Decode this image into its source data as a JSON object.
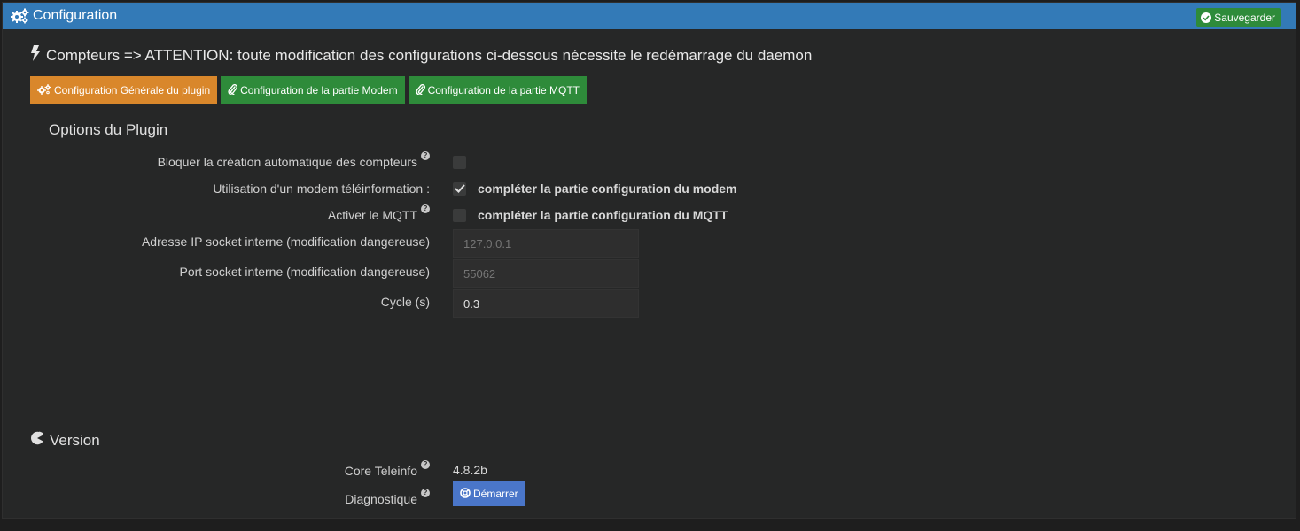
{
  "header": {
    "title": "Configuration",
    "save_label": "Sauvegarder",
    "icon": "cogs-icon",
    "color": "#337ab7"
  },
  "warning": {
    "title": "Compteurs => ATTENTION: toute modification des configurations ci-dessous nécessite le redémarrage du daemon",
    "icon": "bolt-icon"
  },
  "tabs": [
    {
      "label": "Configuration Générale du plugin",
      "icon": "cogs-icon",
      "color": "#d9872b",
      "active": true
    },
    {
      "label": "Configuration de la partie Modem",
      "icon": "paperclip-icon",
      "color": "#2e8b3a",
      "active": false
    },
    {
      "label": "Configuration de la partie MQTT",
      "icon": "paperclip-icon",
      "color": "#2e8b3a",
      "active": false
    }
  ],
  "options": {
    "title": "Options du Plugin",
    "block_auto_creation": {
      "label": "Bloquer la création automatique des compteurs",
      "checked": false
    },
    "use_modem": {
      "label": "Utilisation d'un modem téléinformation :",
      "checked": true,
      "hint": "compléter la partie configuration du modem"
    },
    "mqtt": {
      "label": "Activer le MQTT",
      "checked": false,
      "hint": "compléter la partie configuration du MQTT"
    },
    "socket_ip": {
      "label": "Adresse IP socket interne (modification dangereuse)",
      "placeholder": "127.0.0.1",
      "value": ""
    },
    "socket_port": {
      "label": "Port socket interne (modification dangereuse)",
      "placeholder": "55062",
      "value": ""
    },
    "cycle": {
      "label": "Cycle (s)",
      "value": "0.3"
    }
  },
  "version": {
    "title": "Version",
    "icon": "pie-icon",
    "core_label": "Core Teleinfo",
    "core_value": "4.8.2b",
    "diag_label": "Diagnostique",
    "start_label": "Démarrer"
  }
}
